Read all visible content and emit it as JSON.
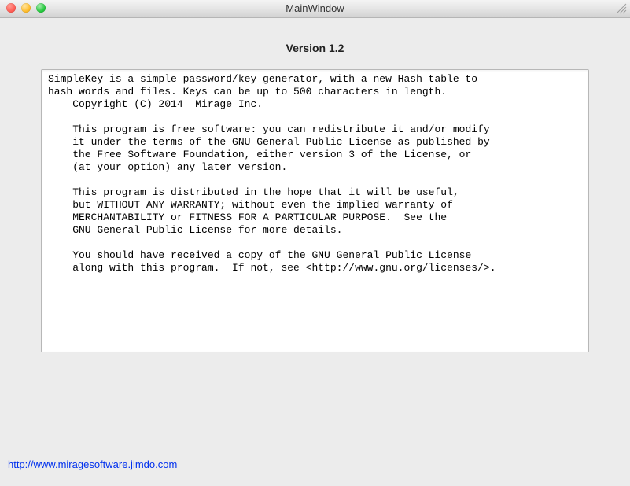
{
  "window": {
    "title": "MainWindow"
  },
  "version_label": "Version 1.2",
  "license_text": "SimpleKey is a simple password/key generator, with a new Hash table to\nhash words and files. Keys can be up to 500 characters in length.\n    Copyright (C) 2014  Mirage Inc.\n\n    This program is free software: you can redistribute it and/or modify\n    it under the terms of the GNU General Public License as published by\n    the Free Software Foundation, either version 3 of the License, or\n    (at your option) any later version.\n\n    This program is distributed in the hope that it will be useful,\n    but WITHOUT ANY WARRANTY; without even the implied warranty of\n    MERCHANTABILITY or FITNESS FOR A PARTICULAR PURPOSE.  See the\n    GNU General Public License for more details.\n\n    You should have received a copy of the GNU General Public License\n    along with this program.  If not, see <http://www.gnu.org/licenses/>.",
  "footer": {
    "link_text": "http://www.miragesoftware.jimdo.com"
  }
}
